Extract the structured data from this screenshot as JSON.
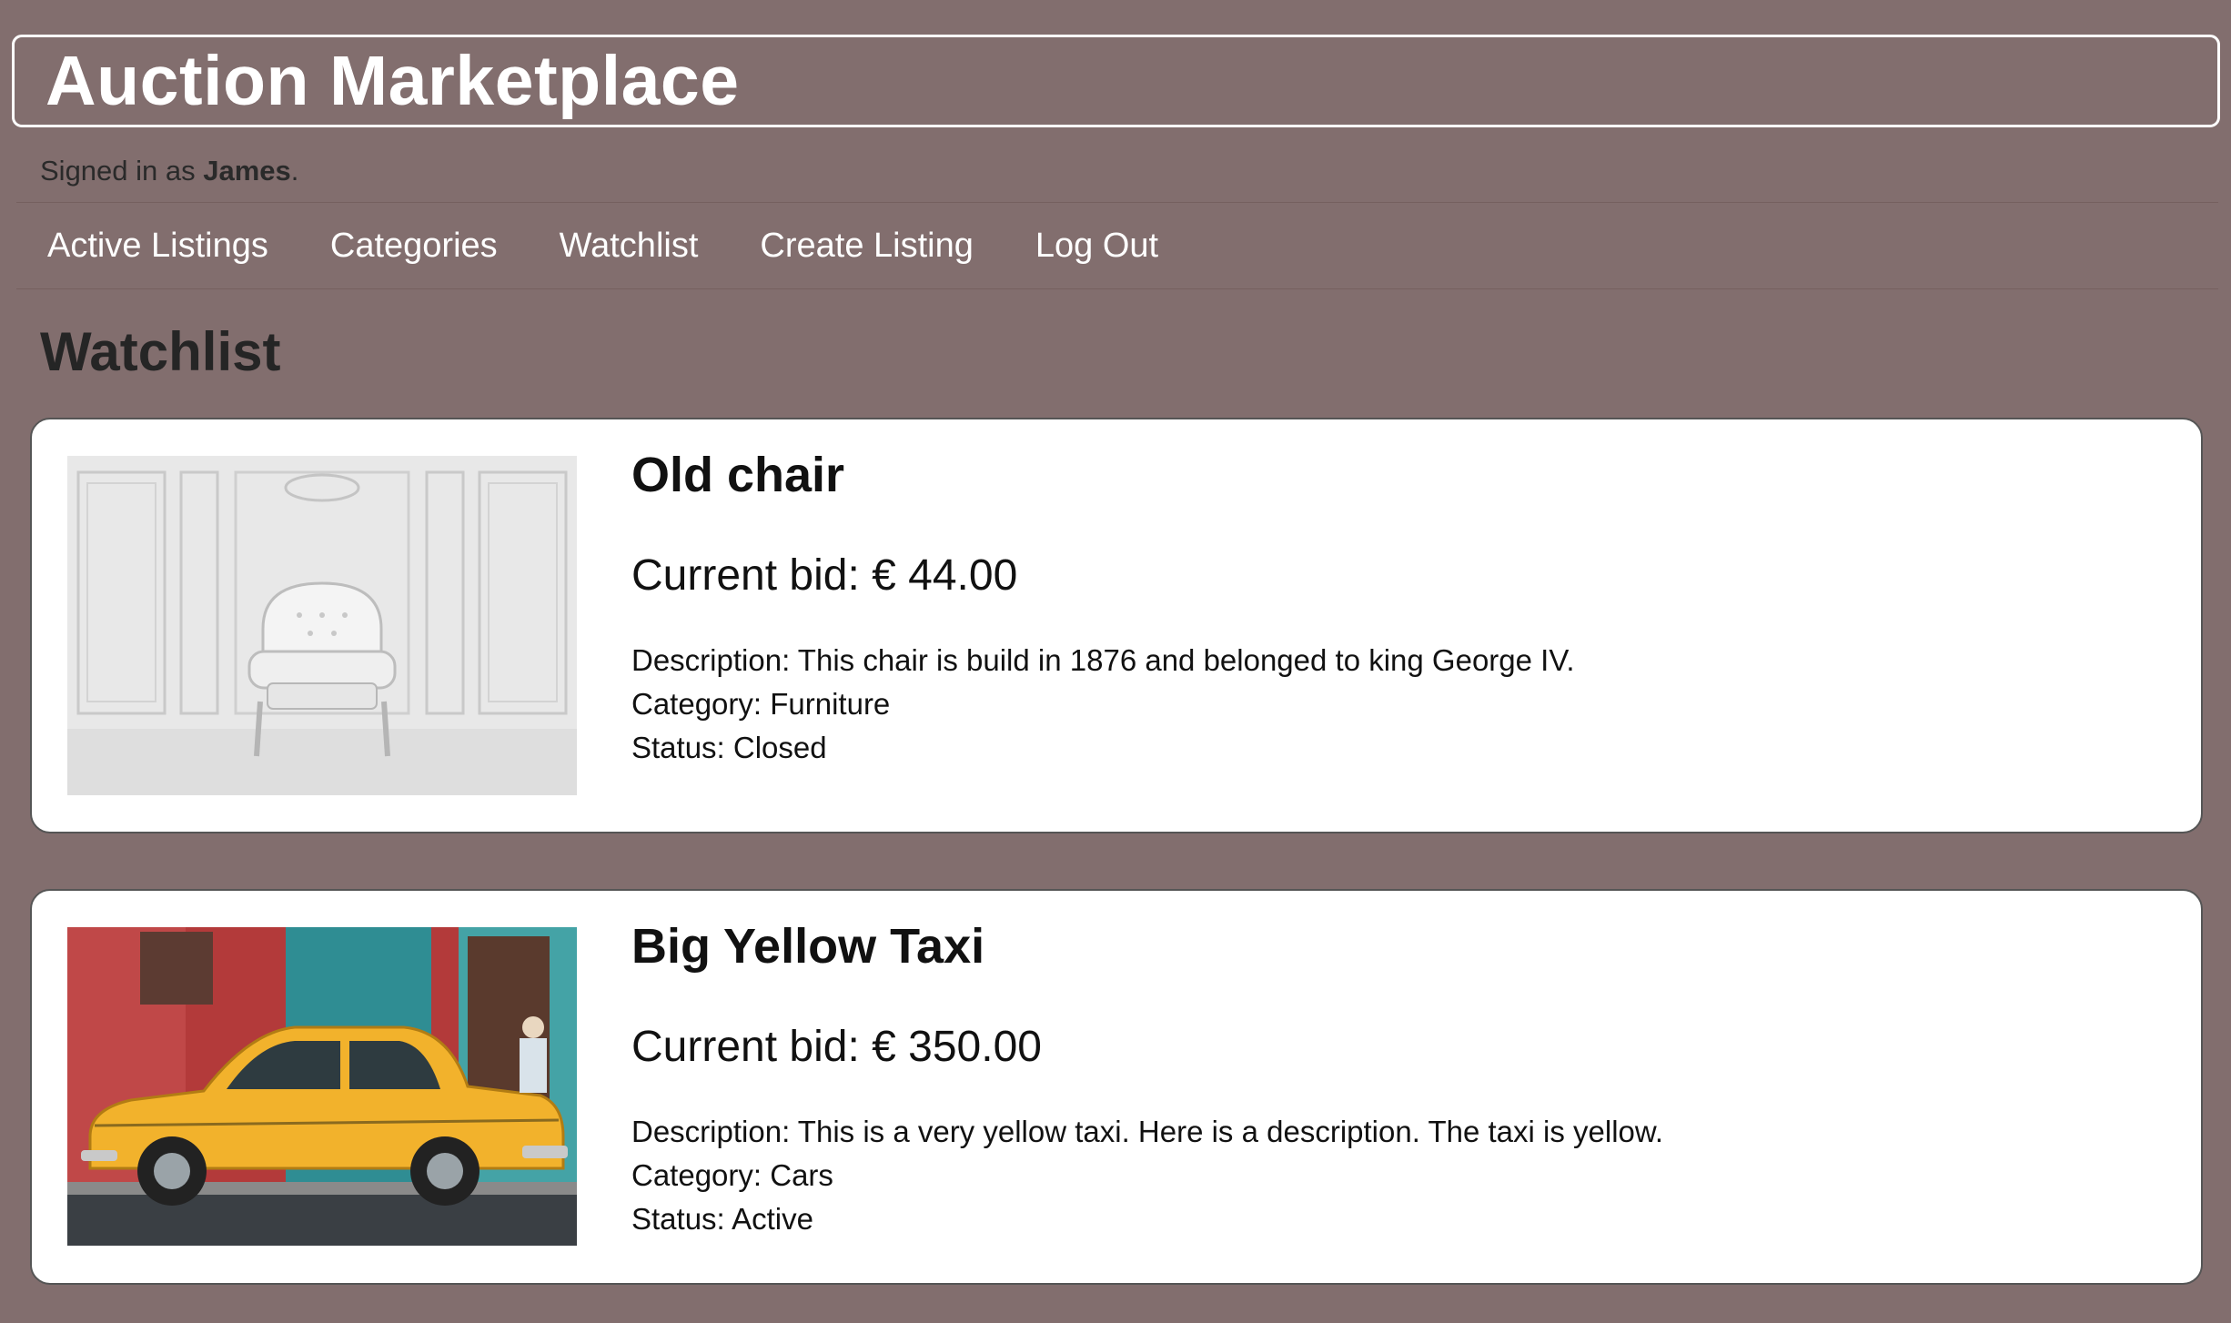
{
  "site": {
    "title": "Auction Marketplace"
  },
  "session": {
    "prefix": "Signed in as ",
    "username": "James",
    "suffix": "."
  },
  "nav": {
    "items": [
      {
        "label": "Active Listings"
      },
      {
        "label": "Categories"
      },
      {
        "label": "Watchlist"
      },
      {
        "label": "Create Listing"
      },
      {
        "label": "Log Out"
      }
    ]
  },
  "page": {
    "heading": "Watchlist"
  },
  "listings": [
    {
      "title": "Old chair",
      "bid": "Current bid: € 44.00",
      "description": "Description: This chair is build in 1876 and belonged to king George IV.",
      "category": "Category: Furniture",
      "status": "Status: Closed",
      "image": "white ornate armchair in a white paneled room"
    },
    {
      "title": "Big Yellow Taxi",
      "bid": "Current bid: € 350.00",
      "description": "Description: This is a very yellow taxi. Here is a description. The taxi is yellow.",
      "category": "Category: Cars",
      "status": "Status: Active",
      "image": "vintage yellow car parked in front of red and teal building"
    }
  ],
  "colors": {
    "background": "#826e6e",
    "card": "#ffffff",
    "taxi": "#f2b22c"
  }
}
